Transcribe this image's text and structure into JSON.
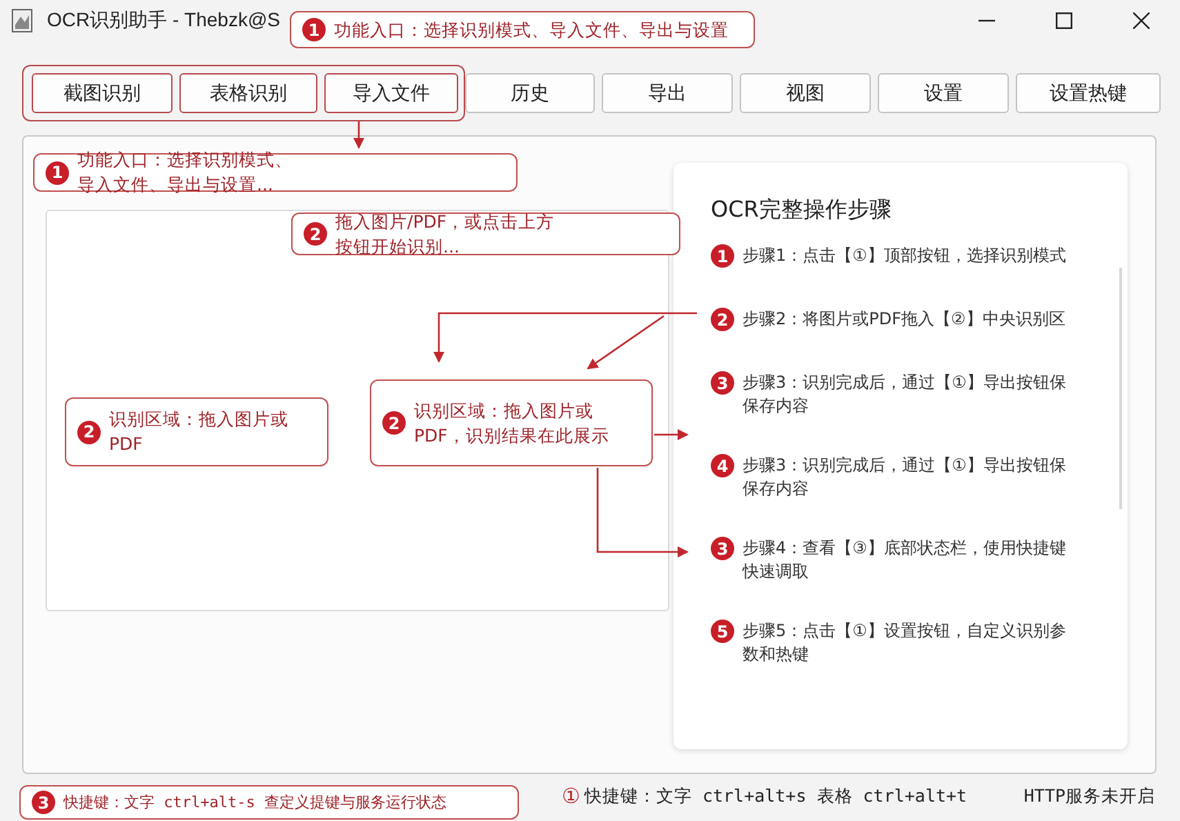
{
  "window": {
    "title": "OCR识别助手 - Thebzk@S",
    "callout": {
      "badge": "1",
      "text": "功能入口：选择识别模式、导入文件、导出与设置"
    }
  },
  "toolbar": [
    {
      "label": "截图识别",
      "highlighted": true
    },
    {
      "label": "表格识别",
      "highlighted": true
    },
    {
      "label": "导入文件",
      "highlighted": true
    },
    {
      "label": "历史",
      "highlighted": false
    },
    {
      "label": "导出",
      "highlighted": false
    },
    {
      "label": "视图",
      "highlighted": false
    },
    {
      "label": "设置",
      "highlighted": false
    },
    {
      "label": "设置热键",
      "highlighted": false
    }
  ],
  "callouts": [
    {
      "badge": "1",
      "text": "功能入口：选择识别模式、导入文件、导出与设置..."
    },
    {
      "badge": "2",
      "text": "拖入图片/PDF，或点击上方按钮开始识别..."
    },
    {
      "badge": "2",
      "text": "识别区域：拖入图片或PDF"
    },
    {
      "badge": "2",
      "text": "识别区域：拖入图片或PDF，识别结果在此展示"
    }
  ],
  "steps_panel": {
    "title": "OCR完整操作步骤",
    "steps": [
      {
        "badge": "1",
        "text": "步骤1：点击【①】顶部按钮，选择识别模式"
      },
      {
        "badge": "2",
        "text": "步骤2：将图片或PDF拖入【②】中央识别区"
      },
      {
        "badge": "3",
        "text": "步骤3：识别完成后，通过【①】导出按钮保保存内容"
      },
      {
        "badge": "4",
        "text": "步骤3：识别完成后，通过【①】导出按钮保保存内容"
      },
      {
        "badge": "3",
        "text": "步骤4：查看【③】底部状态栏，使用快捷键快速调取"
      },
      {
        "badge": "5",
        "text": "步骤5：点击【①】设置按钮，自定义识别参数和热键"
      }
    ]
  },
  "status_bar": {
    "callout": {
      "badge": "3",
      "text": "快捷键：文字 ctrl+alt-s  查定义提键与服务运行状态"
    },
    "mark": "①",
    "shortcuts": "快捷键：文字 ctrl+alt+s  表格 ctrl+alt+t",
    "http_status": "HTTP服务未开启"
  }
}
